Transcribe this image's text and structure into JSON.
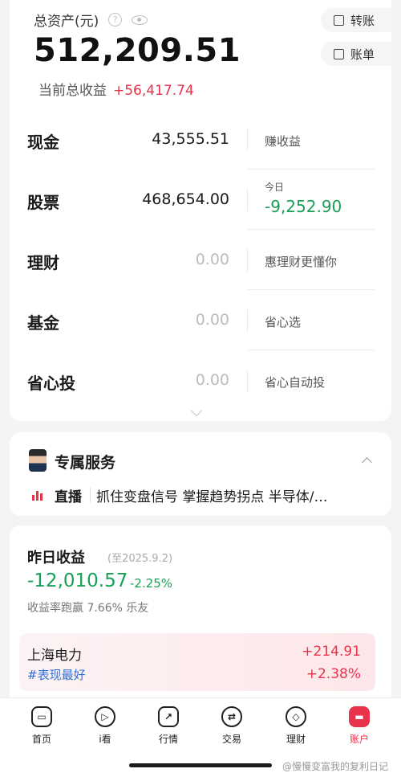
{
  "header": {
    "assets_label": "总资产(元)",
    "total_assets": "512,209.51",
    "pl_label": "当前总收益",
    "pl_value": "+56,417.74",
    "transfer_label": "转账",
    "bill_label": "账单"
  },
  "assets": [
    {
      "name": "现金",
      "amount": "43,555.51",
      "note": "赚收益"
    },
    {
      "name": "股票",
      "amount": "468,654.00",
      "today_label": "今日",
      "today_value": "-9,252.90"
    },
    {
      "name": "理财",
      "amount": "0.00",
      "note": "惠理财更懂你"
    },
    {
      "name": "基金",
      "amount": "0.00",
      "note": "省心选"
    },
    {
      "name": "省心投",
      "amount": "0.00",
      "note": "省心自动投"
    }
  ],
  "service": {
    "title": "专属服务",
    "live_label": "直播",
    "live_text": "抓住变盘信号 掌握趋势拐点  半导体/…"
  },
  "yesterday": {
    "title": "昨日收益",
    "date": "(至2025.9.2)",
    "value": "-12,010.57",
    "pct": "-2.25%",
    "beat_text": "收益率跑赢  7.66%  乐友",
    "best": {
      "name": "上海电力",
      "tag": "#表现最好",
      "amount": "+214.91",
      "pct": "+2.38%"
    }
  },
  "nav": [
    {
      "label": "首页",
      "icon": "home-icon"
    },
    {
      "label": "i看",
      "icon": "play-icon"
    },
    {
      "label": "行情",
      "icon": "chart-icon"
    },
    {
      "label": "交易",
      "icon": "trade-icon"
    },
    {
      "label": "理财",
      "icon": "wealth-icon"
    },
    {
      "label": "账户",
      "icon": "account-icon"
    }
  ],
  "watermark": "@慢慢变富我的复利日记",
  "colors": {
    "up": "#e8344a",
    "down": "#18a058",
    "link": "#2f6fd6"
  }
}
